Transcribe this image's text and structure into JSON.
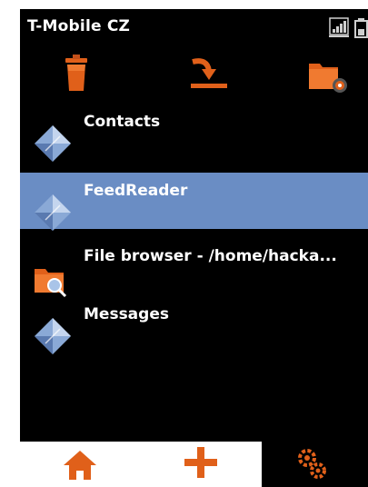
{
  "status": {
    "carrier": "T-Mobile CZ",
    "signal_icon": "signal-strength-icon",
    "battery_icon": "battery-icon"
  },
  "toolbar": {
    "buttons": [
      {
        "icon": "trash-icon"
      },
      {
        "icon": "import-icon"
      },
      {
        "icon": "folder-settings-icon"
      }
    ]
  },
  "apps": [
    {
      "label": "Contacts",
      "icon": "app-diamond-icon",
      "selected": false
    },
    {
      "label": "FeedReader",
      "icon": "app-diamond-icon",
      "selected": true
    },
    {
      "label": "File browser - /home/hacka...",
      "icon": "folder-search-icon",
      "selected": false
    },
    {
      "label": "Messages",
      "icon": "app-diamond-icon",
      "selected": false
    }
  ],
  "bottom_bar": {
    "tabs": [
      {
        "icon": "home-icon",
        "active": true
      },
      {
        "icon": "plus-icon",
        "active": true
      },
      {
        "icon": "gears-icon",
        "active": false
      }
    ]
  },
  "colors": {
    "accent": "#e0601a",
    "selection": "#6a8dc4",
    "background": "#000000"
  }
}
